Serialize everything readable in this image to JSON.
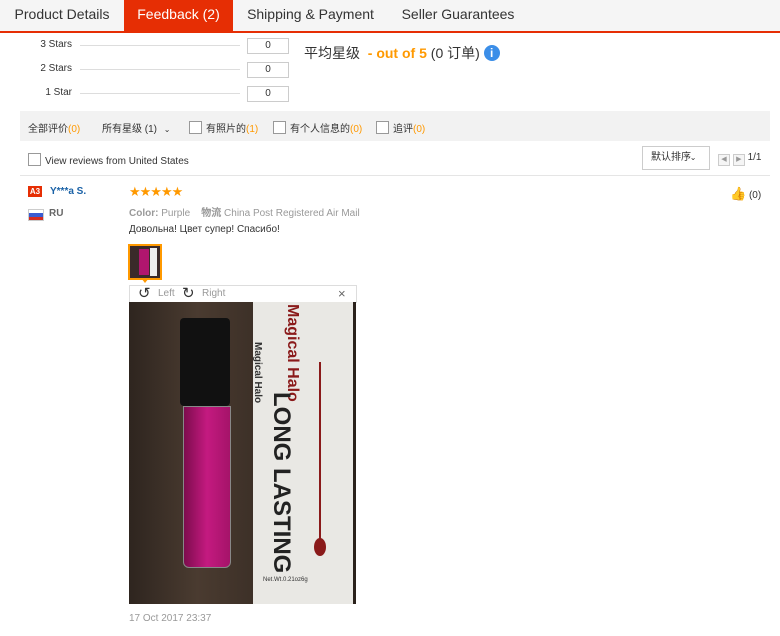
{
  "tabs": [
    {
      "label": "Product Details",
      "active": false
    },
    {
      "label": "Feedback (2)",
      "active": true
    },
    {
      "label": "Shipping & Payment",
      "active": false
    },
    {
      "label": "Seller Guarantees",
      "active": false
    }
  ],
  "rating_rows": [
    {
      "label": "3 Stars",
      "count": "0"
    },
    {
      "label": "2 Stars",
      "count": "0"
    },
    {
      "label": "1 Star",
      "count": "0"
    }
  ],
  "average": {
    "label": "平均星级",
    "score_text": "- out of 5",
    "orders_text": "(0 订单)",
    "info_icon": "info-icon"
  },
  "filters": {
    "all_label": "全部评价",
    "all_count": "(0)",
    "star_select": "所有星级 (1)",
    "with_photos_label": "有照片的",
    "with_photos_count": "(1)",
    "with_info_label": "有个人信息的",
    "with_info_count": "(0)",
    "followup_label": "追评",
    "followup_count": "(0)"
  },
  "view_us_label": "View reviews from United States",
  "sort_label": "默认排序",
  "pager_text": "1/1",
  "review": {
    "level_badge": "A3",
    "username": "Y***a S.",
    "country": "RU",
    "stars": "★★★★★",
    "color_label": "Color:",
    "color_value": "Purple",
    "logistics_label": "物流",
    "logistics_value": "China Post Registered Air Mail",
    "text": "Довольна! Цвет супер! Спасибо!",
    "rotate_left": "Left",
    "rotate_right": "Right",
    "close": "×",
    "date": "17 Oct 2017 23:37",
    "helpful_count": "(0)"
  },
  "photo_text": {
    "brand": "Magical Halo",
    "tagline": "LONG LASTING",
    "weight": "Net.Wt.0.21oz6g"
  },
  "colors": {
    "accent": "#e62e04",
    "orange": "#ff9900",
    "link": "#1a62a7",
    "lipgloss": "#b0166e"
  }
}
